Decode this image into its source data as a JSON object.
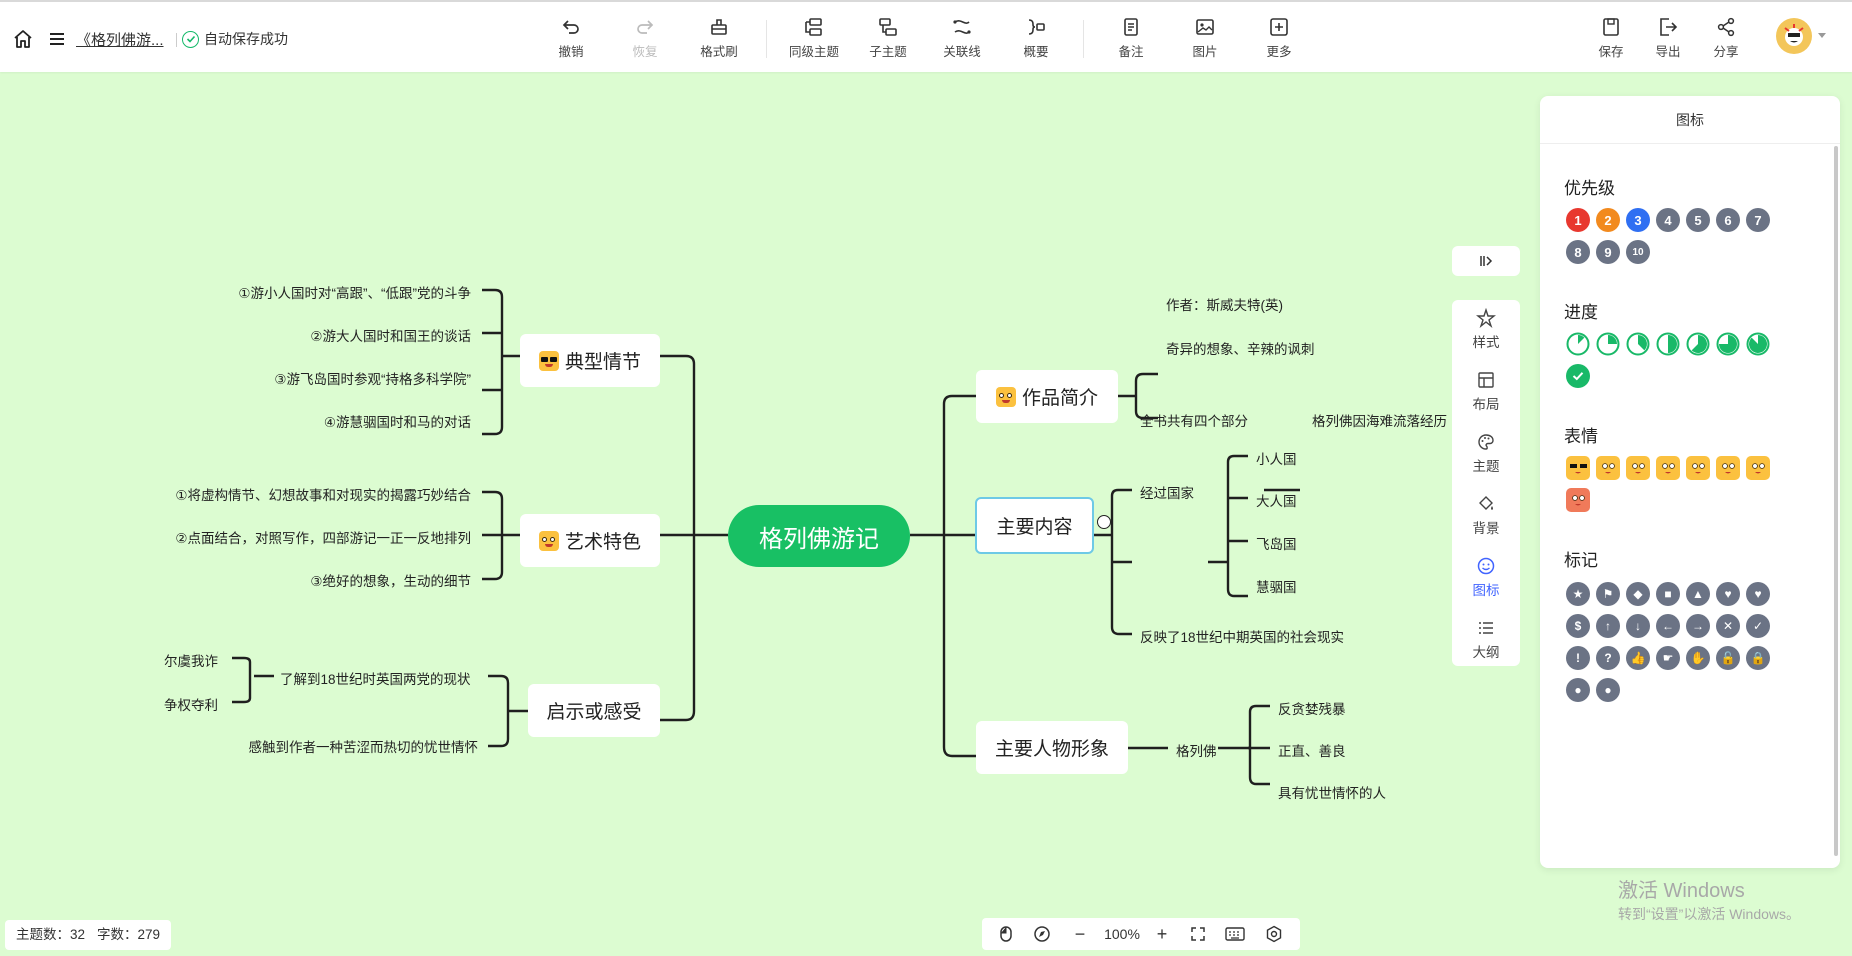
{
  "header": {
    "doc_title": "《格列佛游...",
    "save_status": "自动保存成功"
  },
  "toolbar": {
    "undo": "撤销",
    "redo": "恢复",
    "format_brush": "格式刷",
    "sibling_topic": "同级主题",
    "child_topic": "子主题",
    "relation_line": "关联线",
    "summary": "概要",
    "note": "备注",
    "image": "图片",
    "more": "更多",
    "save": "保存",
    "export": "导出",
    "share": "分享"
  },
  "mindmap": {
    "root": "格列佛游记",
    "left": [
      {
        "title": "典型情节",
        "children": [
          "①游小人国时对“高跟”、“低跟”党的斗争",
          "②游大人国时和国王的谈话",
          "③游飞岛国时参观“持格多科学院”",
          "④游慧骃国时和马的对话"
        ]
      },
      {
        "title": "艺术特色",
        "children": [
          "①将虚构情节、幻想故事和对现实的揭露巧妙结合",
          "②点面结合，对照写作，四部游记一正一反地排列",
          "③绝好的想象，生动的细节"
        ]
      },
      {
        "title": "启示或感受",
        "children": [
          "了解到18世纪时英国两党的现状",
          "感触到作者一种苦涩而热切的忧世情怀"
        ],
        "grandchildren": [
          "尔虞我诈",
          "争权夺利"
        ]
      }
    ],
    "right": [
      {
        "title": "作品简介",
        "children": [
          "作者：斯威夫特(英)",
          "奇异的想象、辛辣的讽刺"
        ]
      },
      {
        "title": "主要内容",
        "children": [
          "全书共有四个部分",
          "经过国家",
          "反映了18世纪中期英国的社会现实"
        ],
        "part_detail": "格列佛因海难流落经历",
        "countries": [
          "小人国",
          "大人国",
          "飞岛国",
          "慧骃国"
        ]
      },
      {
        "title": "主要人物形象",
        "children": [
          "格列佛"
        ],
        "traits": [
          "反贪婪残暴",
          "正直、善良",
          "具有忧世情怀的人"
        ]
      }
    ]
  },
  "side_tools": [
    "样式",
    "布局",
    "主题",
    "背景",
    "图标",
    "大纲"
  ],
  "icon_panel": {
    "title": "图标",
    "sections": {
      "priority": "优先级",
      "progress": "进度",
      "emoji": "表情",
      "mark": "标记"
    },
    "priority_numbers": [
      "1",
      "2",
      "3",
      "4",
      "5",
      "6",
      "7",
      "8",
      "9",
      "10"
    ],
    "priority_colors": [
      "#e8382f",
      "#f28a1e",
      "#2f6ff2",
      "#6b7385",
      "#6b7385",
      "#6b7385",
      "#6b7385",
      "#6b7385",
      "#6b7385",
      "#6b7385"
    ],
    "progress_levels": [
      0.125,
      0.25,
      0.375,
      0.5,
      0.625,
      0.75,
      0.875,
      1.0
    ],
    "emoji_icons": [
      "cool-emoji-icon",
      "smile-emoji-icon",
      "laugh-emoji-icon",
      "sad-emoji-icon",
      "wink-emoji-icon",
      "surprise-emoji-icon",
      "cry-emoji-icon",
      "angry-emoji-icon"
    ],
    "mark_icons": [
      "star-icon",
      "flag-icon",
      "diamond-icon",
      "square-icon",
      "triangle-icon",
      "heart-broken-icon",
      "heart-icon",
      "money-bag-icon",
      "arrow-up-icon",
      "arrow-down-icon",
      "arrow-left-icon",
      "arrow-right-icon",
      "cross-icon",
      "check-icon",
      "exclamation-icon",
      "question-icon",
      "thumbs-up-icon",
      "hand-point-icon",
      "hand-stop-icon",
      "unlock-icon",
      "lock-icon",
      "person-icon",
      "group-icon"
    ]
  },
  "status": {
    "topic_count": "主题数：32",
    "word_count": "字数：279"
  },
  "zoom": {
    "level": "100%",
    "minus": "−",
    "plus": "+"
  },
  "watermark": {
    "line1": "激活 Windows",
    "line2": "转到“设置”以激活 Windows。"
  },
  "colors": {
    "canvas_bg": "#dcfcd1",
    "root_bg": "#18c064",
    "accent_blue": "#4164ff"
  }
}
